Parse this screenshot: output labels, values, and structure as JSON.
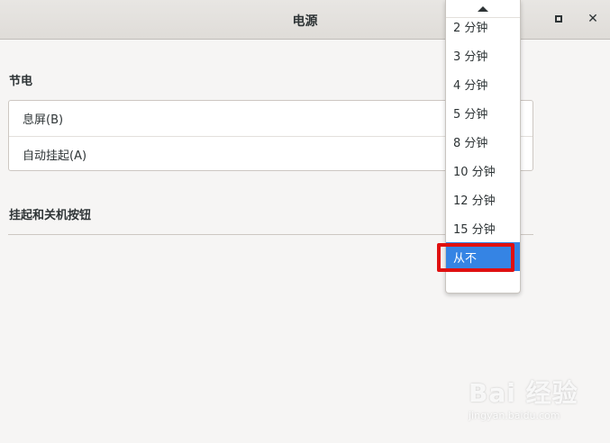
{
  "window": {
    "title": "电源"
  },
  "sections": {
    "power_saving": {
      "title": "节电",
      "rows": [
        "息屏(B)",
        "自动挂起(A)"
      ]
    },
    "buttons": {
      "title": "挂起和关机按钮"
    }
  },
  "popup": {
    "options": [
      "2 分钟",
      "3 分钟",
      "4 分钟",
      "5 分钟",
      "8 分钟",
      "10 分钟",
      "12 分钟",
      "15 分钟",
      "从不"
    ],
    "selected": "从不"
  },
  "watermark": {
    "text": "Bai 经验",
    "sub": "jingyan.baidu.com"
  },
  "colors": {
    "selection": "#3584e4",
    "highlight": "#e01010"
  }
}
